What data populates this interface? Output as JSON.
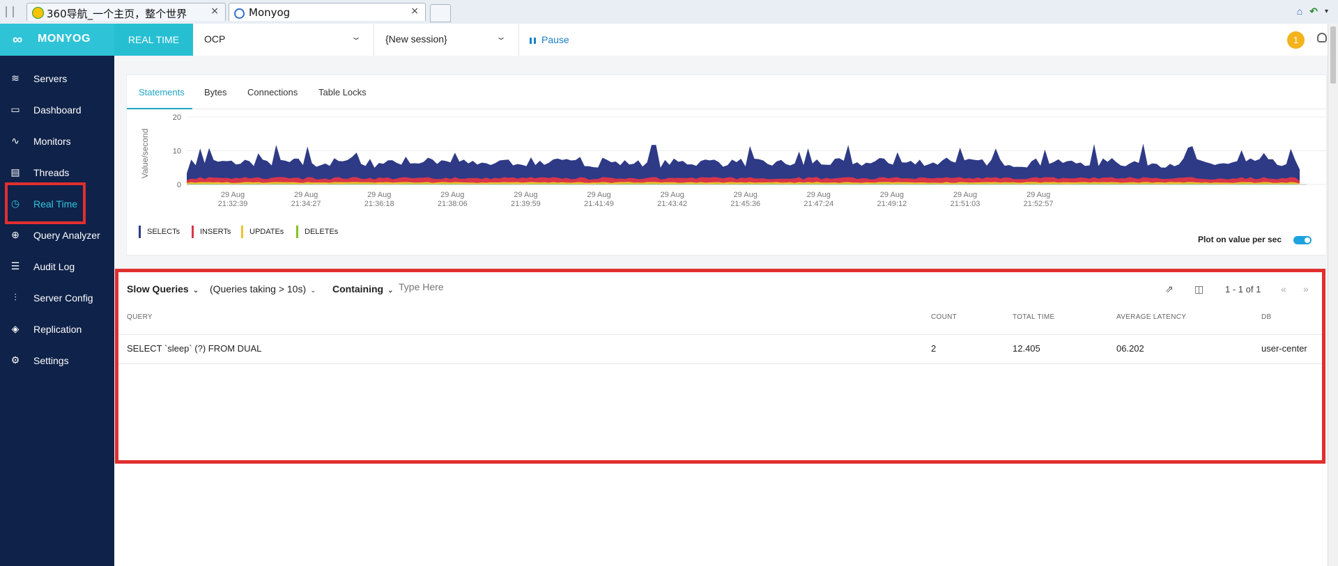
{
  "browser": {
    "tabs": [
      {
        "title": "360导航_一个主页，整个世界",
        "active": false
      },
      {
        "title": "Monyog",
        "active": true
      }
    ],
    "close_glyph": "×"
  },
  "header": {
    "logo_mark": "∞",
    "logo_text": "MONYOG",
    "realtime_label": "REAL TIME",
    "server_select": "OCP",
    "session_select": "{New session}",
    "pause_label": "Pause",
    "notification_count": "1"
  },
  "sidebar": {
    "items": [
      {
        "label": "Servers",
        "icon": "database-icon",
        "glyph": "≋"
      },
      {
        "label": "Dashboard",
        "icon": "monitor-icon",
        "glyph": "▭"
      },
      {
        "label": "Monitors",
        "icon": "pulse-icon",
        "glyph": "∿"
      },
      {
        "label": "Threads",
        "icon": "document-icon",
        "glyph": "▤"
      },
      {
        "label": "Real Time",
        "icon": "clock-icon",
        "glyph": "◷",
        "active": true
      },
      {
        "label": "Query Analyzer",
        "icon": "zoom-icon",
        "glyph": "⊕"
      },
      {
        "label": "Audit Log",
        "icon": "list-icon",
        "glyph": "☰"
      },
      {
        "label": "Server Config",
        "icon": "sliders-icon",
        "glyph": "⫶"
      },
      {
        "label": "Replication",
        "icon": "layers-icon",
        "glyph": "◈"
      },
      {
        "label": "Settings",
        "icon": "gear-icon",
        "glyph": "⚙"
      }
    ]
  },
  "chart_tabs": [
    "Statements",
    "Bytes",
    "Connections",
    "Table Locks"
  ],
  "chart_data": {
    "type": "area",
    "ylabel": "Value/second",
    "ylim": [
      0,
      20
    ],
    "yticks": [
      "20",
      "10",
      "0"
    ],
    "xtick_labels": [
      [
        "29 Aug",
        "21:32:39"
      ],
      [
        "29 Aug",
        "21:34:27"
      ],
      [
        "29 Aug",
        "21:36:18"
      ],
      [
        "29 Aug",
        "21:38:06"
      ],
      [
        "29 Aug",
        "21:39:59"
      ],
      [
        "29 Aug",
        "21:41:49"
      ],
      [
        "29 Aug",
        "21:43:42"
      ],
      [
        "29 Aug",
        "21:45:36"
      ],
      [
        "29 Aug",
        "21:47:24"
      ],
      [
        "29 Aug",
        "21:49:12"
      ],
      [
        "29 Aug",
        "21:51:03"
      ],
      [
        "29 Aug",
        "21:52:57"
      ]
    ],
    "series": [
      {
        "name": "SELECTs",
        "color": "#2e3a86",
        "base": 4.5,
        "spike": 10
      },
      {
        "name": "INSERTs",
        "color": "#d9354a",
        "base": 1.2,
        "spike": 1.5
      },
      {
        "name": "UPDATEs",
        "color": "#f2c230",
        "base": 0.4,
        "spike": 0.5
      },
      {
        "name": "DELETEs",
        "color": "#84c225",
        "base": 0.2,
        "spike": 0.3
      }
    ],
    "plot_toggle_label": "Plot on value per sec"
  },
  "slow_queries": {
    "title": "Slow Queries",
    "filter": "(Queries taking > 10s)",
    "match_mode": "Containing",
    "search_placeholder": "Type Here",
    "pagination": "1 - 1 of 1",
    "columns": [
      "QUERY",
      "COUNT",
      "TOTAL TIME",
      "AVERAGE LATENCY",
      "DB"
    ],
    "rows": [
      {
        "query": "SELECT `sleep` (?) FROM DUAL",
        "count": "2",
        "total_time": "12.405",
        "avg_latency": "06.202",
        "db": "user-center"
      }
    ]
  }
}
